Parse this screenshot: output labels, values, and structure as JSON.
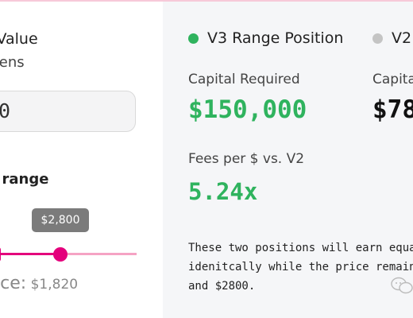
{
  "left_panel": {
    "title": "t Value",
    "subtitle": "okens",
    "input_value": "0",
    "range_label": "e range",
    "tooltip": "$2,800",
    "price_label": "rice:",
    "price_value": "$1,820"
  },
  "v3": {
    "header": "V3 Range Position",
    "capital_label": "Capital Required",
    "capital_value": "$150,000",
    "fees_label": "Fees per $ vs. V2",
    "fees_value": "5.24x",
    "description_lines": [
      "These two positions will earn equal fe",
      "idenitcally while the price remains be",
      "and $2800."
    ]
  },
  "v2": {
    "header": "V2",
    "capital_label": "Capita",
    "capital_value": "$78"
  },
  "colors": {
    "green": "#2fb35e",
    "pink": "#e4007c",
    "pink_light": "#f5a3c4",
    "grey_dot": "#c4c4c4",
    "panel_bg": "#f5f6f8"
  },
  "icons": {
    "watermark": "chat-bubbles-icon"
  }
}
